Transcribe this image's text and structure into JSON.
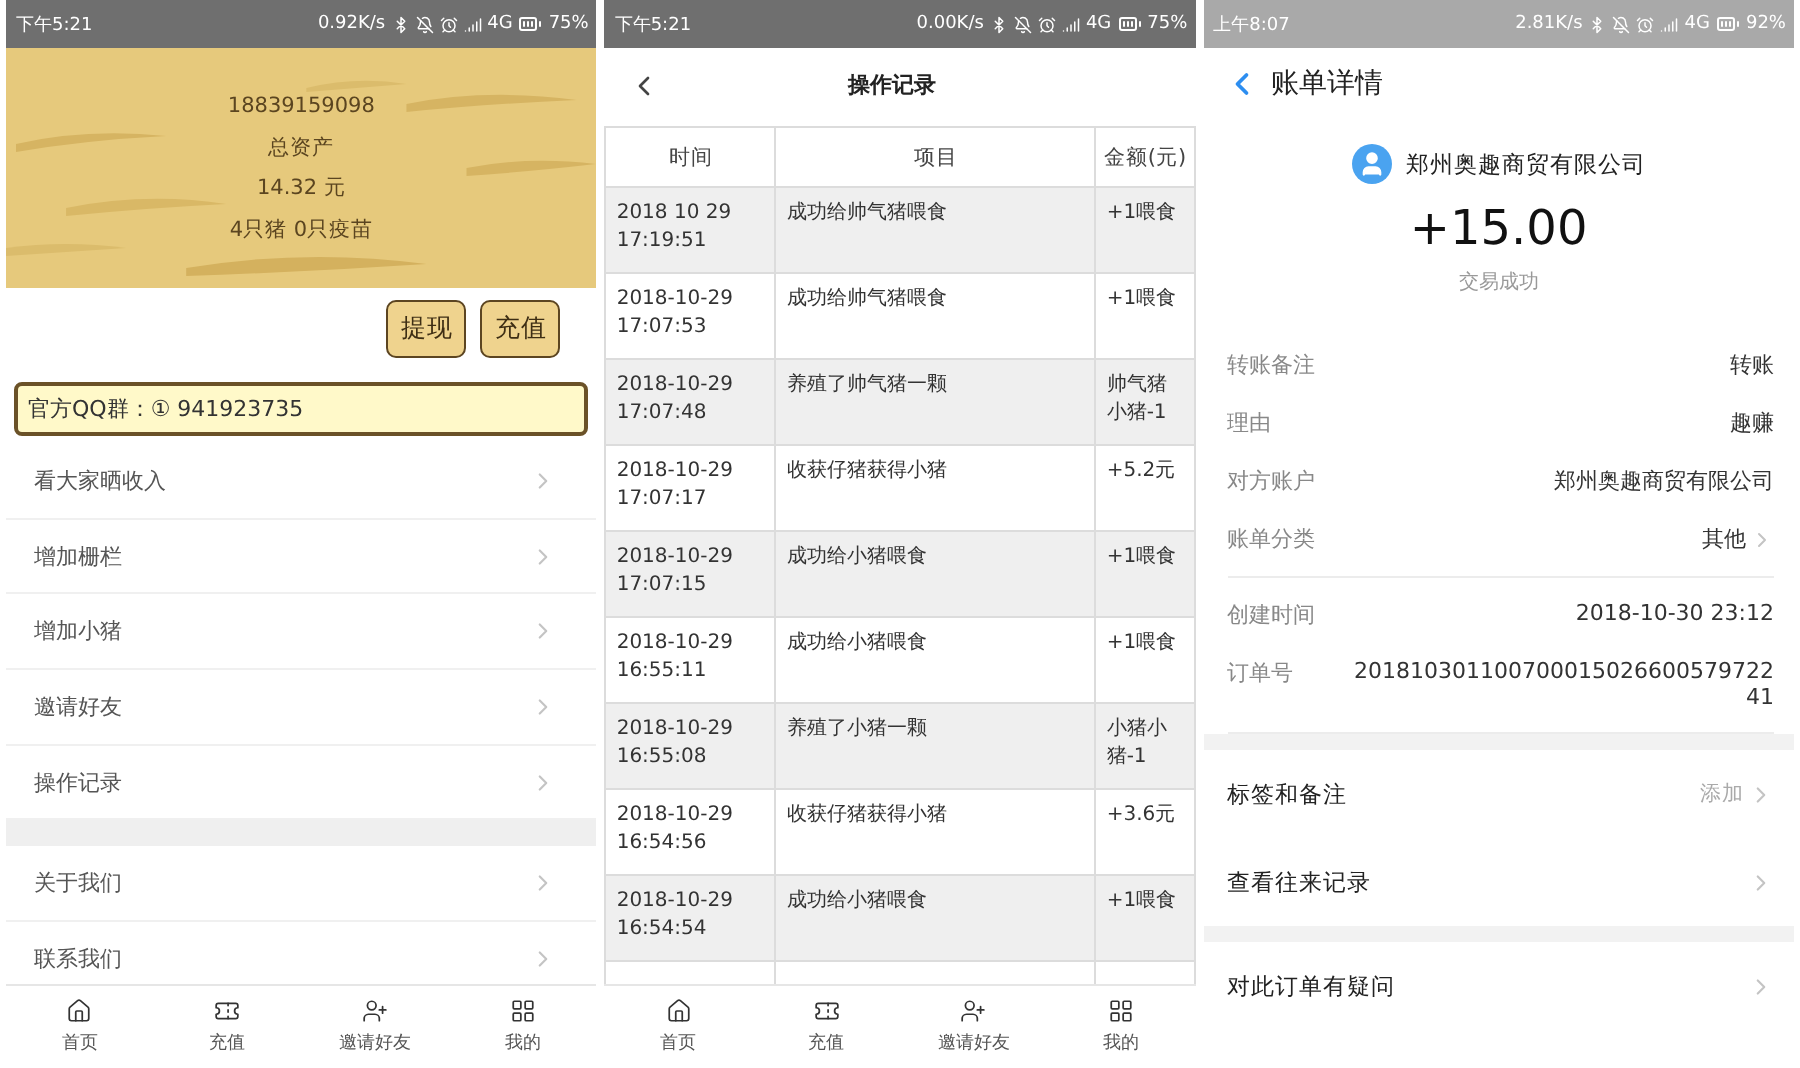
{
  "home_screen": {
    "status_bar": {
      "time": "下午5:21",
      "speed": "0.92K/s",
      "network": "4G",
      "battery": "75%"
    },
    "account": {
      "phone": "18839159098",
      "label": "总资产",
      "amount": "14.32 元",
      "pigs": "4只猪 0只疫苗"
    },
    "buttons": [
      "提现",
      "充值"
    ],
    "notice": "官方QQ群：① 941923735",
    "menu_groups": [
      [
        "看大家晒收入",
        "增加栅栏",
        "增加小猪",
        "邀请好友",
        "操作记录"
      ],
      [
        "关于我们",
        "联系我们"
      ]
    ],
    "tab_bar": [
      "首页",
      "充值",
      "邀请好友",
      "我的"
    ]
  },
  "records_screen": {
    "status_bar": {
      "time": "下午5:21",
      "speed": "0.00K/s",
      "network": "4G",
      "battery": "75%"
    },
    "title": "操作记录",
    "table": {
      "columns": [
        "时间",
        "项目",
        "金额(元)"
      ],
      "rows": [
        [
          "2018 10 29 17:19:51",
          "成功给帅气猪喂食",
          "+1喂食"
        ],
        [
          "2018-10-29 17:07:53",
          "成功给帅气猪喂食",
          "+1喂食"
        ],
        [
          "2018-10-29 17:07:48",
          "养殖了帅气猪一颗",
          "帅气猪小猪-1"
        ],
        [
          "2018-10-29 17:07:17",
          "收获仔猪获得小猪",
          "+5.2元"
        ],
        [
          "2018-10-29 17:07:15",
          "成功给小猪喂食",
          "+1喂食"
        ],
        [
          "2018-10-29 16:55:11",
          "成功给小猪喂食",
          "+1喂食"
        ],
        [
          "2018-10-29 16:55:08",
          "养殖了小猪一颗",
          "小猪小猪-1"
        ],
        [
          "2018-10-29 16:54:56",
          "收获仔猪获得小猪",
          "+3.6元"
        ],
        [
          "2018-10-29 16:54:54",
          "成功给小猪喂食",
          "+1喂食"
        ]
      ]
    },
    "tab_bar": [
      "首页",
      "充值",
      "邀请好友",
      "我的"
    ]
  },
  "bill_screen": {
    "status_bar": {
      "time": "上午8:07",
      "speed": "2.81K/s",
      "network": "4G",
      "battery": "92%"
    },
    "title": "账单详情",
    "payer": "郑州奥趣商贸有限公司",
    "amount": "+15.00",
    "status": "交易成功",
    "detail_groups": [
      [
        {
          "kind": "info",
          "label": "转账备注",
          "value": "转账"
        },
        {
          "kind": "info",
          "label": "理由",
          "value": "趣赚"
        },
        {
          "kind": "info",
          "label": "对方账户",
          "value": "郑州奥趣商贸有限公司"
        },
        {
          "kind": "link",
          "label": "账单分类",
          "value": "其他"
        }
      ],
      [
        {
          "kind": "info",
          "label": "创建时间",
          "value": "2018-10-30 23:12"
        },
        {
          "kind": "info",
          "label": "订单号",
          "value": "20181030110070001502660057972241"
        }
      ]
    ],
    "action_groups": [
      [
        {
          "label": "标签和备注",
          "value": "添加"
        },
        {
          "label": "查看往来记录"
        }
      ],
      [
        {
          "label": "对此订单有疑问"
        }
      ]
    ]
  }
}
